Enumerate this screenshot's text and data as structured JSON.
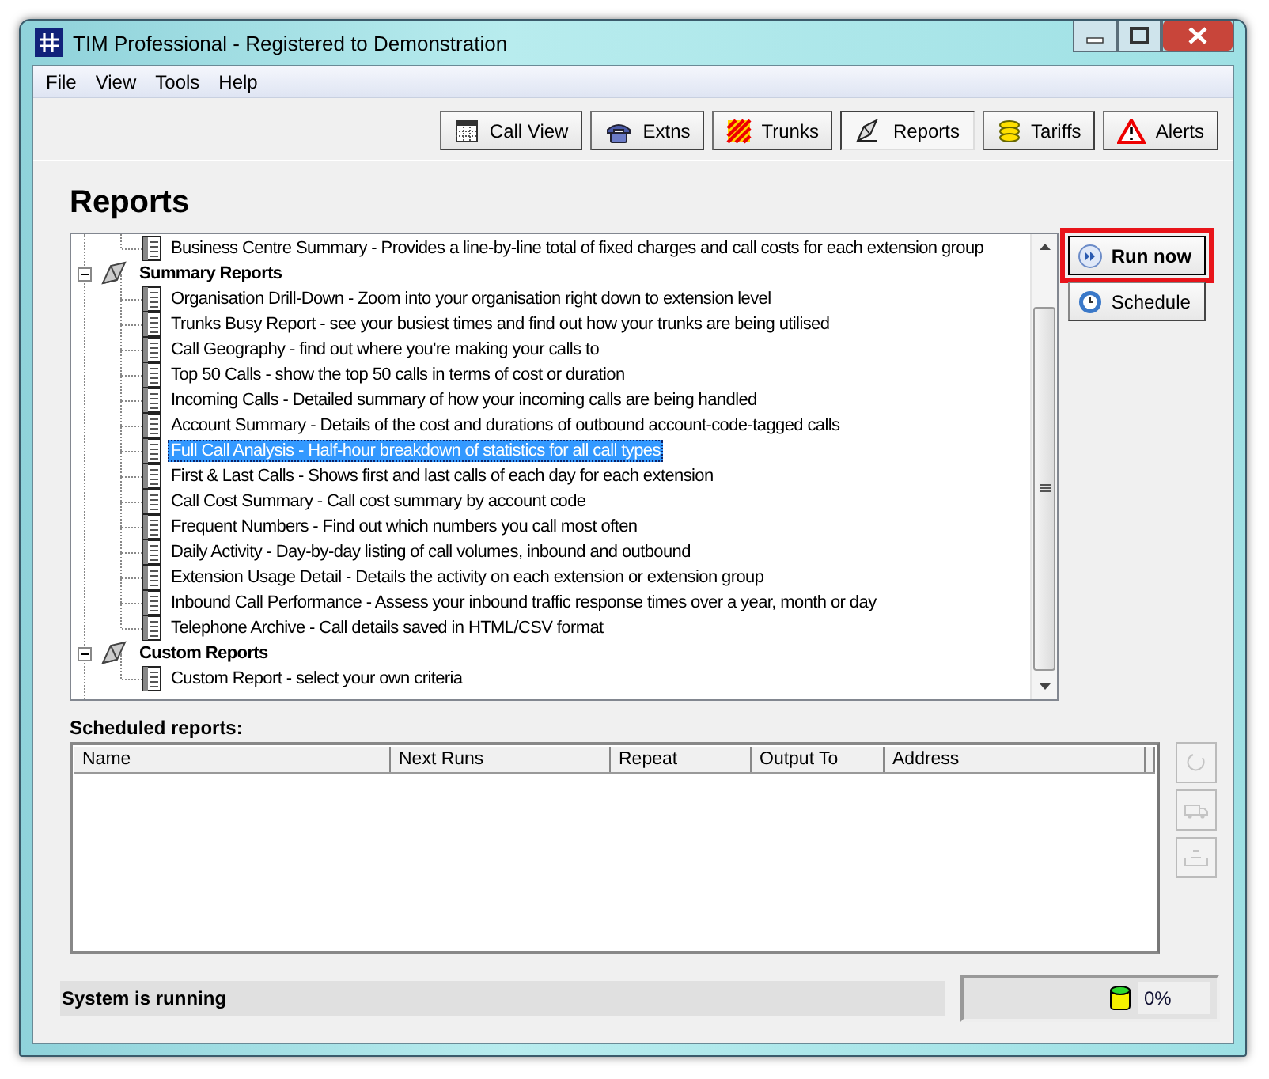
{
  "window": {
    "title": "TIM Professional - Registered to Demonstration"
  },
  "menu": [
    "File",
    "View",
    "Tools",
    "Help"
  ],
  "toolbar": [
    {
      "label": "Call View",
      "kind": "grid",
      "selected": false
    },
    {
      "label": "Extns",
      "kind": "phone",
      "selected": false
    },
    {
      "label": "Trunks",
      "kind": "stripes",
      "selected": false
    },
    {
      "label": "Reports",
      "kind": "pen",
      "selected": true
    },
    {
      "label": "Tariffs",
      "kind": "coins",
      "selected": false
    },
    {
      "label": "Alerts",
      "kind": "warning",
      "selected": false
    }
  ],
  "heading": "Reports",
  "tree": [
    {
      "kind": "report",
      "label": "Business Centre Summary - Provides a line-by-line total of fixed charges and call costs for each extension group",
      "selected": false
    },
    {
      "kind": "group",
      "label": "Summary Reports",
      "expanded": true,
      "children": [
        {
          "kind": "report",
          "label": "Organisation Drill-Down - Zoom into your organisation right down to extension level",
          "selected": false
        },
        {
          "kind": "report",
          "label": "Trunks Busy Report - see your busiest times and find out how your trunks are being utilised",
          "selected": false
        },
        {
          "kind": "report",
          "label": "Call Geography - find out where you're making your calls to",
          "selected": false
        },
        {
          "kind": "report",
          "label": "Top 50 Calls - show the top 50 calls in terms of cost or duration",
          "selected": false
        },
        {
          "kind": "report",
          "label": "Incoming Calls - Detailed summary of how your incoming calls are being handled",
          "selected": false
        },
        {
          "kind": "report",
          "label": "Account Summary - Details of the cost and durations of outbound account-code-tagged calls",
          "selected": false
        },
        {
          "kind": "report",
          "label": "Full Call Analysis - Half-hour breakdown of statistics for all call types",
          "selected": true
        },
        {
          "kind": "report",
          "label": "First & Last Calls - Shows first and last calls of each day for each extension",
          "selected": false
        },
        {
          "kind": "report",
          "label": "Call Cost Summary - Call cost summary by account code",
          "selected": false
        },
        {
          "kind": "report",
          "label": "Frequent Numbers - Find out which numbers you call most often",
          "selected": false
        },
        {
          "kind": "report",
          "label": "Daily Activity - Day-by-day listing of call volumes, inbound and outbound",
          "selected": false
        },
        {
          "kind": "report",
          "label": "Extension Usage Detail - Details the activity on each extension or extension group",
          "selected": false
        },
        {
          "kind": "report",
          "label": "Inbound Call Performance - Assess your inbound traffic response times over a year, month or day",
          "selected": false
        },
        {
          "kind": "report",
          "label": "Telephone Archive - Call details saved in HTML/CSV format",
          "selected": false
        }
      ]
    },
    {
      "kind": "group",
      "label": "Custom Reports",
      "expanded": true,
      "children": [
        {
          "kind": "report",
          "label": "Custom Report - select your own criteria",
          "selected": false
        }
      ]
    }
  ],
  "actions": [
    {
      "label": "Run now",
      "kind": "play",
      "highlighted": true
    },
    {
      "label": "Schedule",
      "kind": "clock",
      "highlighted": false
    }
  ],
  "scheduled": {
    "label": "Scheduled reports:",
    "columns": [
      "Name",
      "Next Runs",
      "Repeat",
      "Output To",
      "Address"
    ],
    "side_buttons": [
      {
        "kind": "refresh",
        "disabled": true
      },
      {
        "kind": "truck",
        "disabled": true
      },
      {
        "kind": "tray",
        "disabled": true
      }
    ]
  },
  "status_bar": {
    "message": "System is running",
    "percent": "0%"
  }
}
